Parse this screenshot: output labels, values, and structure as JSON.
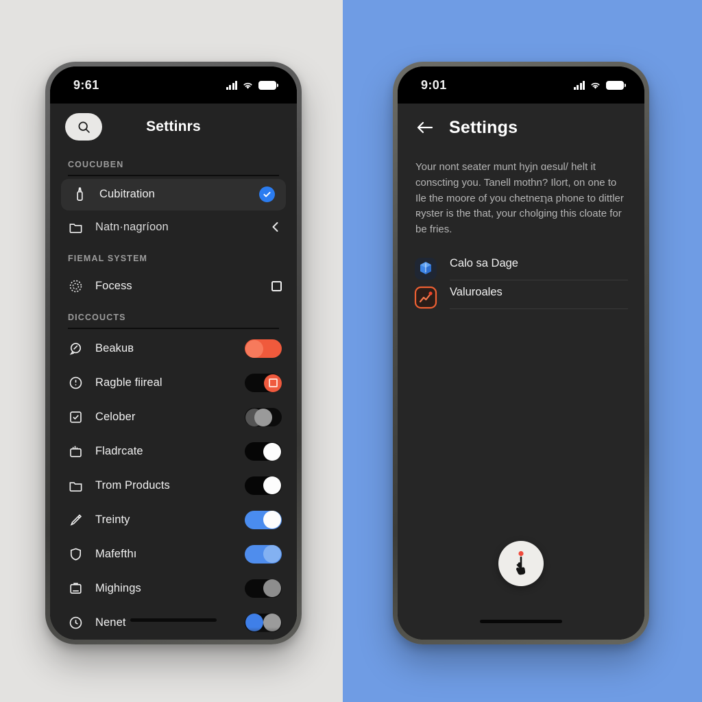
{
  "canvas": {
    "left_panel_bg": "#e3e2e0",
    "right_panel_bg": "#6f9ce4",
    "accent_blue": "#2b7cf0",
    "accent_orange": "#f05a3c",
    "screen_bg_dark": "#232323"
  },
  "left_phone": {
    "status": {
      "time": "9:61",
      "signal_icon": "cellular-signal-icon",
      "wifi_icon": "wifi-icon",
      "battery_icon": "battery-icon"
    },
    "header": {
      "title": "Settinrs",
      "search_icon": "search-icon"
    },
    "sections": [
      {
        "title": "COUCUBEN",
        "rows": [
          {
            "label": "Cubitration",
            "icon": "bottle-icon",
            "control": "check-blue",
            "selected": true
          },
          {
            "label": "Natn·nagríoon",
            "icon": "folder-icon",
            "control": "chevron-left",
            "selected": false
          }
        ]
      },
      {
        "title": "FIEMAl SYSTEM",
        "rows": [
          {
            "label": "Focess",
            "icon": "dotted-circle-icon",
            "control": "checkbox-empty",
            "selected": false
          }
        ]
      },
      {
        "title": "DICCOUCTS",
        "rows": [
          {
            "label": "Beakuʙ",
            "icon": "speech-bubble-icon",
            "control": "toggle",
            "toggle_style": "t-orange-full"
          },
          {
            "label": "Ragble fiireal",
            "icon": "clock-alert-icon",
            "control": "toggle",
            "toggle_style": "t-black-orange"
          },
          {
            "label": "Celober",
            "icon": "checkbox-square-icon",
            "control": "toggle",
            "toggle_style": "t-gray"
          },
          {
            "label": "Fladrcate",
            "icon": "chart-card-icon",
            "control": "toggle",
            "toggle_style": "t-white"
          },
          {
            "label": "Trom Products",
            "icon": "folder-icon",
            "control": "toggle",
            "toggle_style": "t-white"
          },
          {
            "label": "Treinty",
            "icon": "pencil-icon",
            "control": "toggle",
            "toggle_style": "t-blue"
          },
          {
            "label": "Mafefthı",
            "icon": "shield-icon",
            "control": "toggle",
            "toggle_style": "t-blue-soft"
          },
          {
            "label": "Mighings",
            "icon": "id-card-icon",
            "control": "toggle",
            "toggle_style": "t-dark-gray"
          },
          {
            "label": "Nenet",
            "icon": "clock-icon",
            "control": "toggle",
            "toggle_style": "t-blue-half"
          }
        ]
      }
    ]
  },
  "right_phone": {
    "status": {
      "time": "9:01",
      "signal_icon": "cellular-signal-icon",
      "wifi_icon": "wifi-icon",
      "battery_icon": "battery-icon"
    },
    "header": {
      "title": "Settings",
      "back_icon": "arrow-left-icon"
    },
    "body_text": "Your nont seater munt hyjn ɑesul/ helt it consϲting you. Tanell mothn? Ilort, on one to Ile the moore of you chetneɪɿa phone to dittler ʀуster is the that, your cholging this cloate for be fries.",
    "list": [
      {
        "label": "Calo sa Dage",
        "icon": "blue-cube-icon"
      },
      {
        "label": "Valuroales",
        "icon": "orange-chart-app-icon"
      }
    ],
    "fab": {
      "icon": "pointer-down-icon",
      "badge_color": "#ef4a3c"
    }
  }
}
